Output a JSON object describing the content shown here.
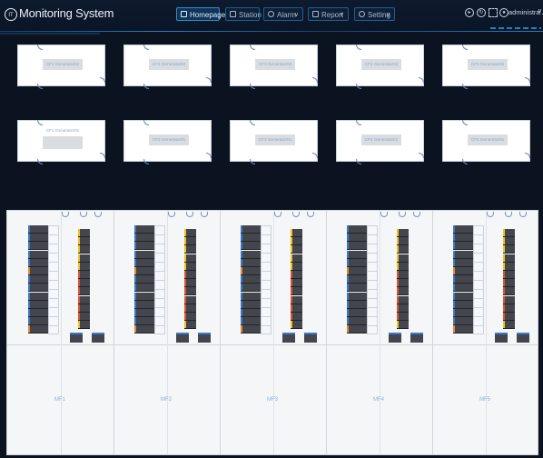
{
  "app": {
    "logo_text": "IT",
    "title": "Monitoring System"
  },
  "nav": [
    {
      "label": "Homepage",
      "active": true,
      "has_chevron": false,
      "icon": "grid-icon"
    },
    {
      "label": "Station",
      "active": false,
      "has_chevron": false,
      "icon": "station-icon"
    },
    {
      "label": "Alarm",
      "active": false,
      "has_chevron": true,
      "icon": "alarm-icon"
    },
    {
      "label": "Report",
      "active": false,
      "has_chevron": true,
      "icon": "report-icon"
    },
    {
      "label": "Setting",
      "active": false,
      "has_chevron": true,
      "icon": "gear-icon"
    }
  ],
  "header_right": {
    "icons": [
      "play-icon",
      "refresh-icon",
      "fullscreen-icon",
      "user-icon"
    ],
    "user_name": "administra...",
    "chevron": "∨"
  },
  "generators_row1": [
    {
      "label": "CF1 Generator02"
    },
    {
      "label": "CF2 Generator02"
    },
    {
      "label": "CF3 Generator02"
    },
    {
      "label": "CF4 Generator02"
    },
    {
      "label": "CF5 Generator02"
    }
  ],
  "generators_row2": [
    {
      "label": "CF1 Generator01"
    },
    {
      "label": "CF2 Generator01"
    },
    {
      "label": "CF3 Generator01"
    },
    {
      "label": "CF4 Generator01"
    },
    {
      "label": "CF5 Generator01"
    }
  ],
  "zones": [
    {
      "label": "MF1"
    },
    {
      "label": "MF2"
    },
    {
      "label": "MF3"
    },
    {
      "label": "MF4"
    },
    {
      "label": "MF5"
    }
  ],
  "colors": {
    "background": "#0b1220",
    "accent": "#2d8bc7",
    "rack": "#44464d",
    "tick_blue": "#3b78c8",
    "tick_orange": "#e58a2b",
    "bar_yellow": "#f2c21a",
    "bar_red": "#e0542e"
  }
}
